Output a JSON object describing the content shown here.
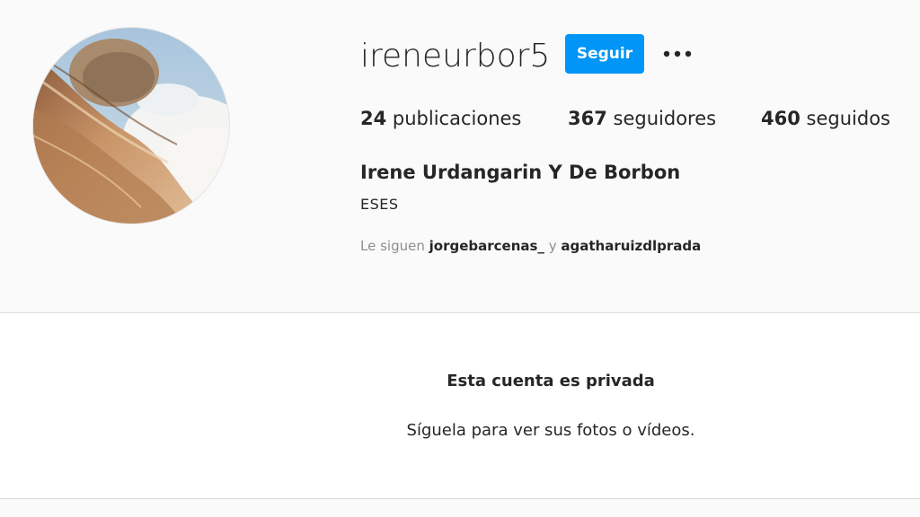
{
  "profile": {
    "username": "ireneurbor5",
    "follow_button_label": "Seguir",
    "more_options_icon": "more-horizontal-icon",
    "avatar_alt": "profile-photo"
  },
  "stats": {
    "posts_count": "24",
    "posts_label": "publicaciones",
    "followers_count": "367",
    "followers_label": "seguidores",
    "following_count": "460",
    "following_label": "seguidos"
  },
  "bio": {
    "full_name": "Irene Urdangarin Y De Borbon",
    "text": "ESES"
  },
  "followed_by": {
    "prefix": "Le siguen",
    "account_1": "jorgebarcenas_",
    "connector": "y",
    "account_2": "agatharuizdlprada"
  },
  "private_notice": {
    "title": "Esta cuenta es privada",
    "subtitle": "Síguela para ver sus fotos o vídeos."
  },
  "colors": {
    "accent_blue": "#0095f6",
    "background": "#fafafa",
    "text_primary": "#262626",
    "text_secondary": "#8e8e8e",
    "border": "#dbdbdb"
  }
}
